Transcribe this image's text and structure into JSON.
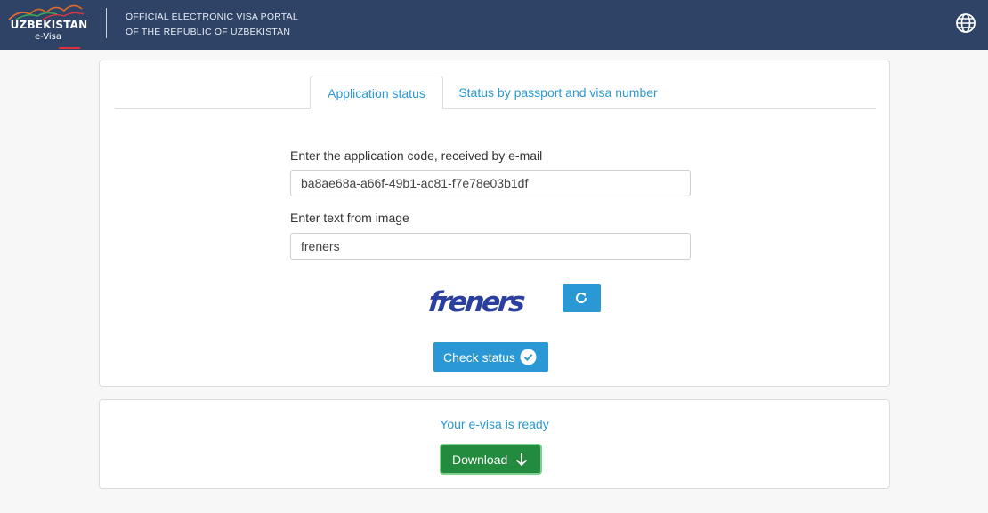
{
  "header": {
    "logo_text": "UZBEKISTAN",
    "logo_subtext": "e-Visa",
    "portal_title_line1": "OFFICIAL ELECTRONIC VISA PORTAL",
    "portal_title_line2": "OF THE REPUBLIC OF UZBEKISTAN",
    "language_icon": "globe-icon"
  },
  "tabs": [
    {
      "label": "Application status",
      "active": true
    },
    {
      "label": "Status by passport and visa number",
      "active": false
    }
  ],
  "form": {
    "code_label": "Enter the application code, received by e-mail",
    "code_value": "ba8ae68a-a66f-49b1-ac81-f7e78e03b1df",
    "captcha_label": "Enter text from image",
    "captcha_value": "freners",
    "captcha_image_text": "freners",
    "refresh_icon": "refresh-icon",
    "check_button_label": "Check status",
    "check_button_icon": "check-circle-icon"
  },
  "result": {
    "message": "Your e-visa is ready",
    "download_button_label": "Download",
    "download_icon": "arrow-down-icon"
  },
  "colors": {
    "header_bg": "#2e4366",
    "accent": "#2a98d4",
    "download_bg": "#228b3e",
    "page_bg": "#f7f7f7"
  }
}
